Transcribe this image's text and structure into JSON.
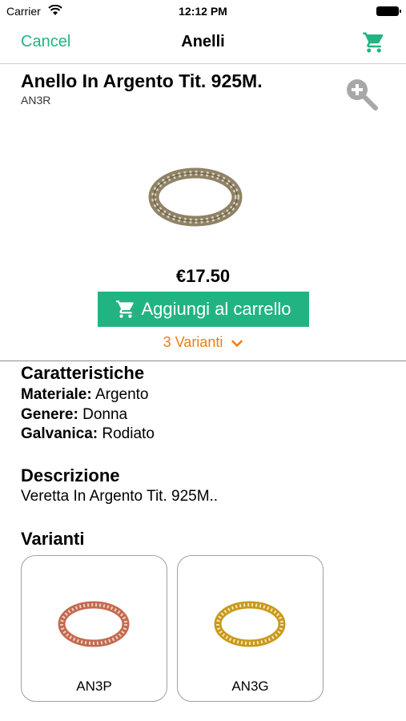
{
  "status_bar": {
    "carrier": "Carrier",
    "time": "12:12 PM"
  },
  "nav": {
    "cancel_label": "Cancel",
    "title": "Anelli",
    "cart_icon": "shopping-cart-icon"
  },
  "product": {
    "title": "Anello In Argento Tit. 925M.",
    "code": "AN3R",
    "price": "€17.50",
    "add_to_cart_label": "Aggiungi al carrello",
    "variants_toggle_label": "3 Varianti"
  },
  "characteristics": {
    "title": "Caratteristiche",
    "rows": [
      {
        "label": "Materiale:",
        "value": "Argento"
      },
      {
        "label": "Genere:",
        "value": "Donna"
      },
      {
        "label": "Galvanica:",
        "value": "Rodiato"
      }
    ]
  },
  "description": {
    "title": "Descrizione",
    "text": "Veretta In Argento Tit. 925M.."
  },
  "variants": {
    "title": "Varianti",
    "items": [
      {
        "code": "AN3P",
        "color": "#d9836a"
      },
      {
        "code": "AN3G",
        "color": "#e0b534"
      }
    ]
  },
  "colors": {
    "accent": "#22b383",
    "orange": "#f07c12",
    "ring_main": "#a59676"
  }
}
